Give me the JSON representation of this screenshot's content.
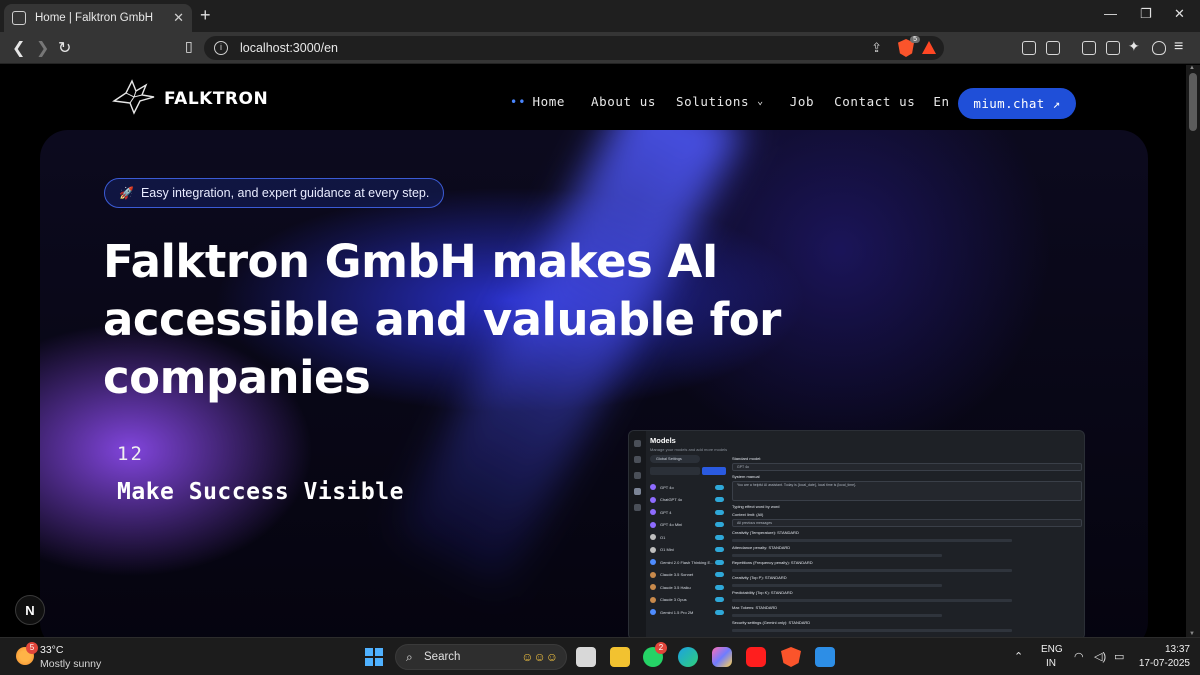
{
  "browser": {
    "tab_title": "Home | Falktron GmbH",
    "url": "localhost:3000/en",
    "brave_shield_count": "5"
  },
  "site": {
    "logo_text": "FALKTRON",
    "nav": {
      "home": "Home",
      "about": "About us",
      "solutions": "Solutions",
      "job": "Job",
      "contact": "Contact us",
      "language": "En"
    },
    "cta_label": "mium.chat ↗",
    "pill_text": "Easy integration, and expert guidance at every step.",
    "headline": "Falktron GmbH makes AI accessible and valuable for companies",
    "counter": "12",
    "tagline": "Make Success Visible",
    "next_badge": "N"
  },
  "preview": {
    "title": "Models",
    "subtitle": "Manage your models and add more models",
    "global_settings": "Global Settings",
    "search_placeholder": "Search models",
    "reorder": "Reorder",
    "standard_model_label": "Standard model:",
    "standard_model_value": "GPT 4o",
    "system_manual_label": "System manual",
    "system_manual_value": "You are a helpful AI assistant. Today is {local_date}, local time is {local_time}.",
    "typing_effect": "Typing effect word by word",
    "context_limit_label": "Context limit: (All)",
    "context_limit_value": "All previous messages",
    "settings": [
      "Creativity (Temperature): STANDARD",
      "Attendance penalty: STANDARD",
      "Repetitions (Frequency penalty): STANDARD",
      "Creativity (Top P): STANDARD",
      "Predictability (Top K): STANDARD",
      "Max Tokens: STANDARD",
      "Security settings (Gemini only): STANDARD"
    ],
    "models": [
      {
        "name": "GPT 4o",
        "color": "#8e6bff"
      },
      {
        "name": "ChatGPT 4o",
        "color": "#8e6bff"
      },
      {
        "name": "GPT 4",
        "color": "#8e6bff"
      },
      {
        "name": "GPT 4o Mini",
        "color": "#8e6bff"
      },
      {
        "name": "O1",
        "color": "#bfbfbf"
      },
      {
        "name": "O1 Mini",
        "color": "#bfbfbf"
      },
      {
        "name": "Gemini 2.0 Flash Thinking E...",
        "color": "#4e8cff"
      },
      {
        "name": "Claude 3.5 Sonnet",
        "color": "#c98a4b"
      },
      {
        "name": "Claude 3.5 Haiku",
        "color": "#c98a4b"
      },
      {
        "name": "Claude 3 Opus",
        "color": "#c98a4b"
      },
      {
        "name": "Gemini 1.5 Pro 2M",
        "color": "#4e8cff"
      }
    ]
  },
  "taskbar": {
    "temperature": "33°C",
    "condition": "Mostly sunny",
    "weather_badge": "5",
    "search_label": "Search",
    "whatsapp_badge": "2",
    "lang_top": "ENG",
    "lang_bottom": "IN",
    "time": "13:37",
    "date": "17-07-2025"
  },
  "colors": {
    "accent_blue": "#1f4fd8",
    "hero_purple": "#9650ff",
    "brave_orange": "#fb542b"
  }
}
